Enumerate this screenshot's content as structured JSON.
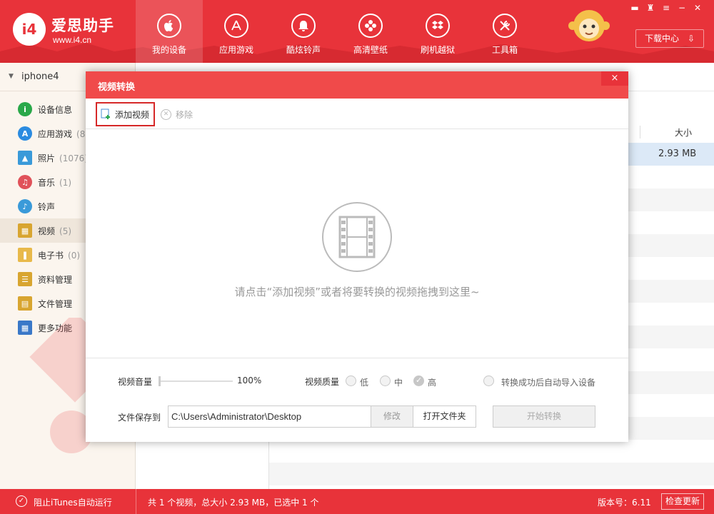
{
  "colors": {
    "brand_red": "#e8333a",
    "modal_title_red": "#f04a4a",
    "sidebar_bg": "#fbf5ee",
    "selection_blue": "#dce9f7"
  },
  "header": {
    "app_name": "爱思助手",
    "url": "www.i4.cn",
    "logo_icon": "i4-logo-icon",
    "nav": [
      {
        "label": "我的设备",
        "icon": "apple-icon",
        "active": true
      },
      {
        "label": "应用游戏",
        "icon": "app-store-icon",
        "active": false
      },
      {
        "label": "酷炫铃声",
        "icon": "bell-icon",
        "active": false
      },
      {
        "label": "高清壁纸",
        "icon": "flower-icon",
        "active": false
      },
      {
        "label": "刷机越狱",
        "icon": "dropbox-icon",
        "active": false
      },
      {
        "label": "工具箱",
        "icon": "tools-icon",
        "active": false
      }
    ],
    "download_center": "下载中心",
    "window_controls": [
      "message-icon",
      "skin-icon",
      "menu-icon",
      "minimize-icon",
      "close-icon"
    ]
  },
  "sidebar": {
    "device": "iphone4",
    "items": [
      {
        "label": "设备信息",
        "count": "",
        "icon": "info-icon",
        "color": "#2aa84a"
      },
      {
        "label": "应用游戏",
        "count": "(8",
        "icon": "app-store-icon",
        "color": "#2b8be0"
      },
      {
        "label": "照片",
        "count": "(1076)",
        "icon": "photo-icon",
        "color": "#3a9ad9"
      },
      {
        "label": "音乐",
        "count": "(1)",
        "icon": "music-icon",
        "color": "#e0525a"
      },
      {
        "label": "铃声",
        "count": "",
        "icon": "bell-icon",
        "color": "#3a9ad9"
      },
      {
        "label": "视频",
        "count": "(5)",
        "icon": "film-icon",
        "color": "#d8a530"
      },
      {
        "label": "电子书",
        "count": "(0)",
        "icon": "book-icon",
        "color": "#e8b94a"
      },
      {
        "label": "资料管理",
        "count": "",
        "icon": "contacts-icon",
        "color": "#d8a530"
      },
      {
        "label": "文件管理",
        "count": "",
        "icon": "file-icon",
        "color": "#d8a530"
      },
      {
        "label": "更多功能",
        "count": "",
        "icon": "grid-icon",
        "color": "#3a78c8"
      }
    ],
    "active_index": 5
  },
  "content": {
    "column_size_label": "大小",
    "row_size": "2.93 MB"
  },
  "modal": {
    "title": "视频转换",
    "close_label": "×",
    "add_video": "添加视频",
    "remove": "移除",
    "empty_hint": "请点击“添加视频”或者将要转换的视频拖拽到这里~",
    "volume_label": "视频音量",
    "volume_value": "100%",
    "volume_level": 1.0,
    "quality_label": "视频质量",
    "quality_options": [
      "低",
      "中",
      "高"
    ],
    "quality_selected": "高",
    "auto_import_label": "转换成功后自动导入设备",
    "save_to_label": "文件保存到",
    "save_path": "C:\\Users\\Administrator\\Desktop",
    "modify": "修改",
    "open_folder": "打开文件夹",
    "start": "开始转换"
  },
  "statusbar": {
    "block_itunes": "阻止iTunes自动运行",
    "summary": "共 1 个视频，总大小 2.93 MB，已选中 1 个",
    "version": "版本号：6.11",
    "check_update": "检查更新"
  }
}
